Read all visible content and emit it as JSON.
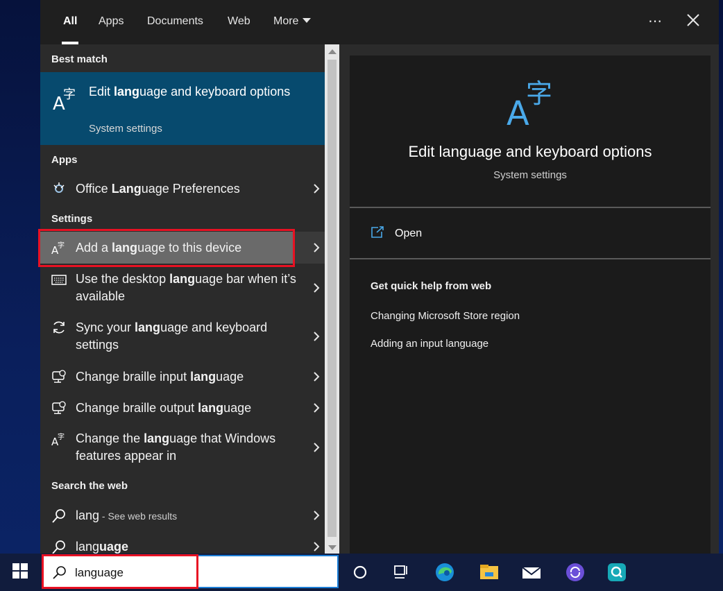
{
  "tabs": [
    {
      "label": "All",
      "active": true
    },
    {
      "label": "Apps"
    },
    {
      "label": "Documents"
    },
    {
      "label": "Web"
    },
    {
      "label": "More"
    }
  ],
  "best_match": {
    "heading": "Best match",
    "title_pre": "Edit ",
    "title_bold": "lang",
    "title_post": "uage and keyboard options",
    "subtitle": "System settings",
    "icon": "language-icon"
  },
  "apps": {
    "heading": "Apps",
    "items": [
      {
        "pre": "Office ",
        "bold": "Lang",
        "post": "uage Preferences",
        "icon": "office-language-icon"
      }
    ]
  },
  "settings": {
    "heading": "Settings",
    "items": [
      {
        "pre": "Add a ",
        "bold": "lang",
        "post": "uage to this device",
        "icon": "language-icon",
        "selected": true
      },
      {
        "pre": "Use the desktop ",
        "bold": "lang",
        "post": "uage bar when it’s available",
        "icon": "keyboard-icon"
      },
      {
        "pre": "Sync your ",
        "bold": "lang",
        "post": "uage and keyboard settings",
        "icon": "sync-icon"
      },
      {
        "pre": "Change braille input ",
        "bold": "lang",
        "post": "uage",
        "icon": "braille-icon"
      },
      {
        "pre": "Change braille output ",
        "bold": "lang",
        "post": "uage",
        "icon": "braille-icon"
      },
      {
        "pre": "Change the ",
        "bold": "lang",
        "post": "uage that Windows features appear in",
        "icon": "language-icon"
      }
    ]
  },
  "web": {
    "heading": "Search the web",
    "items": [
      {
        "main": "lang",
        "note": " - See web results",
        "icon": "search-icon"
      },
      {
        "pre": "lang",
        "bold": "uage",
        "icon": "search-icon"
      }
    ]
  },
  "preview": {
    "title": "Edit language and keyboard options",
    "subtitle": "System settings",
    "open_label": "Open",
    "help_heading": "Get quick help from web",
    "help_links": [
      "Changing Microsoft Store region",
      "Adding an input language"
    ]
  },
  "taskbar": {
    "search_value": "language",
    "icons": [
      "cortana-icon",
      "task-view-icon",
      "edge-icon",
      "file-explorer-icon",
      "mail-icon",
      "app-icon",
      "app-icon-2"
    ]
  },
  "colors": {
    "accent": "#074a6e",
    "highlight": "#e81123",
    "selected_row": "#6a6a6a"
  }
}
